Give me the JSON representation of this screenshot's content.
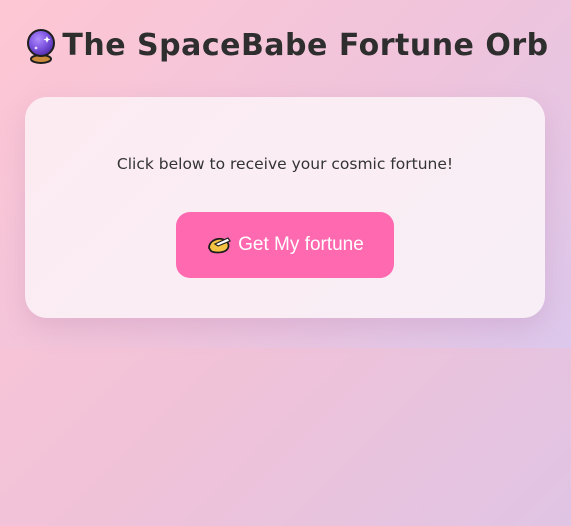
{
  "header": {
    "title": "The SpaceBabe Fortune Orb",
    "title_icon": "crystal-ball-icon"
  },
  "card": {
    "prompt": "Click below to receive your cosmic fortune!",
    "button_label": "Get My fortune",
    "button_icon": "fortune-cookie-icon"
  },
  "colors": {
    "button_bg": "#ff69b0",
    "title_text": "#2e2e2e",
    "card_bg": "#fbedf4"
  }
}
